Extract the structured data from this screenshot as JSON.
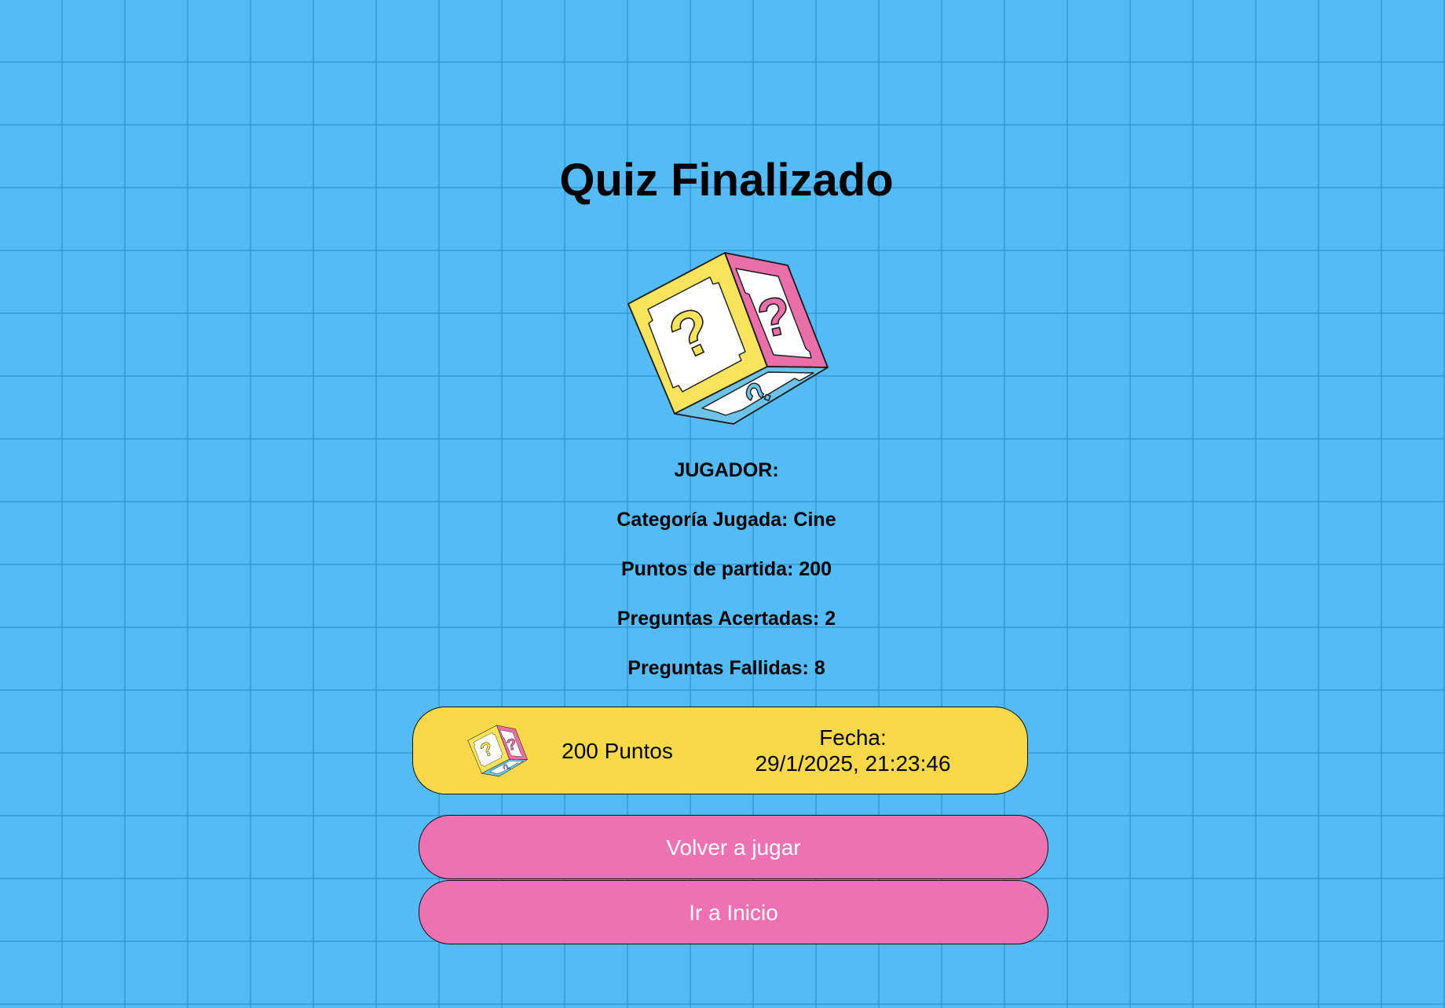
{
  "header": {
    "title": "Quiz Finalizado"
  },
  "logo": {
    "icon": "question-cube-icon",
    "colors": {
      "yellow": "#f7e45a",
      "pink": "#ea6ea8",
      "blue": "#6cc3e8"
    }
  },
  "results": {
    "player": "JUGADOR:",
    "category": "Categoría Jugada: Cine",
    "points": "Puntos de partida: 200",
    "correct": "Preguntas Acertadas: 2",
    "failed": "Preguntas Fallidas: 8"
  },
  "score_card": {
    "icon": "question-cube-icon",
    "points": "200 Puntos",
    "date_label": "Fecha:",
    "date_value": "29/1/2025, 21:23:46"
  },
  "actions": {
    "play_again": "Volver a jugar",
    "go_home": "Ir a Inicio"
  },
  "colors": {
    "background": "#53bcf7",
    "card": "#f9d84a",
    "button": "#ee72b3"
  }
}
